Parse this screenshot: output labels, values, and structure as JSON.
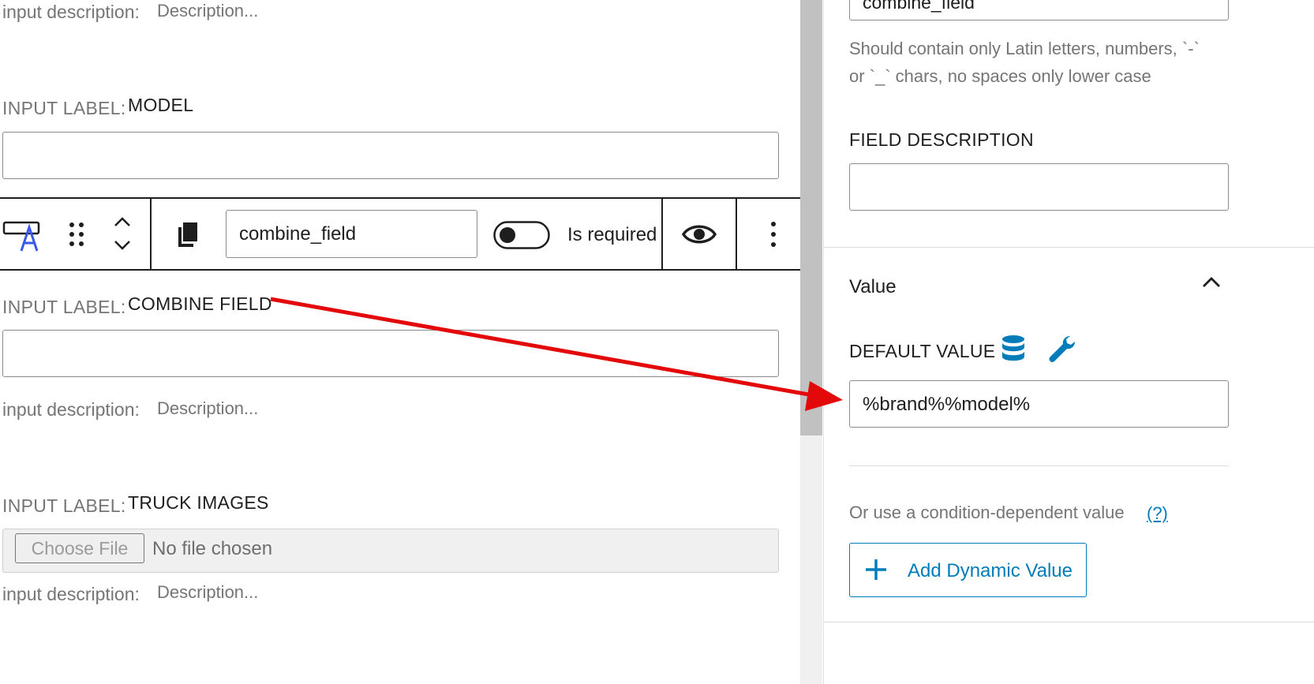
{
  "fields": {
    "top_description": {
      "key": "input description:",
      "value": "Description..."
    },
    "model": {
      "label_key": "INPUT LABEL:",
      "label_value": "MODEL"
    },
    "combine": {
      "label_key": "INPUT LABEL:",
      "label_value": "COMBINE FIELD",
      "desc_key": "input description:",
      "desc_value": "Description..."
    },
    "truck_images": {
      "label_key": "INPUT LABEL:",
      "label_value": "TRUCK IMAGES",
      "choose_file": "Choose File",
      "no_file": "No file chosen",
      "desc_key": "input description:",
      "desc_value": "Description..."
    }
  },
  "toolbar": {
    "field_name": "combine_field",
    "is_required": "Is required",
    "toggle_on": false
  },
  "sidebar": {
    "name_value_partial": "combine_field",
    "name_help": [
      "Should contain only Latin letters, numbers, `-`",
      "or `_` chars, no spaces only lower case"
    ],
    "field_description_label": "FIELD DESCRIPTION",
    "value_section_title": "Value",
    "default_value_label": "DEFAULT VALUE",
    "default_value": "%brand%%model%",
    "condition_text": "Or use a condition-dependent value",
    "condition_help": "(?)",
    "add_dynamic_label": "Add Dynamic Value"
  },
  "colors": {
    "accent": "#007cba",
    "arrow": "#e3080a",
    "text": "#1e1e1e",
    "muted": "#757575"
  },
  "icons": [
    "text-field-icon",
    "drag-handle-icon",
    "chevron-up-icon",
    "chevron-down-icon",
    "copy-icon",
    "eye-icon",
    "more-vertical-icon",
    "database-icon",
    "wrench-icon",
    "chevron-up-icon",
    "plus-icon"
  ]
}
